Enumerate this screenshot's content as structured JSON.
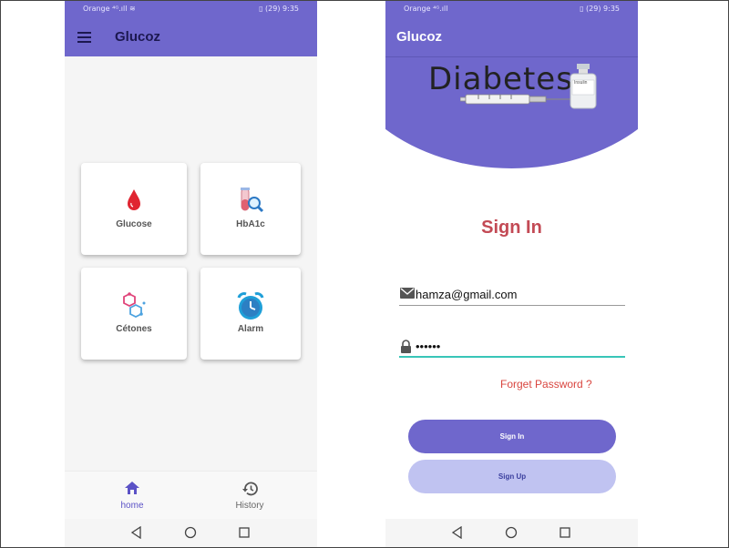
{
  "status_bar": {
    "carrier": "Orange",
    "signal": "⁴ᴳ.ıll",
    "battery": "29",
    "time": "9:35"
  },
  "left_screen": {
    "title": "Glucoz",
    "tiles": [
      {
        "label": "Glucose",
        "icon": "blood-drop-icon"
      },
      {
        "label": "HbA1c",
        "icon": "test-tube-magnifier-icon"
      },
      {
        "label": "Cétones",
        "icon": "molecule-icon"
      },
      {
        "label": "Alarm",
        "icon": "alarm-clock-icon"
      }
    ],
    "bottom_nav": [
      {
        "label": "home",
        "icon": "home-icon",
        "active": true
      },
      {
        "label": "History",
        "icon": "history-icon",
        "active": false
      }
    ]
  },
  "right_screen": {
    "title": "Glucoz",
    "banner_text": "Diabetes",
    "vial_label": "Insulin",
    "heading": "Sign In",
    "email_value": "hamza@gmail.com",
    "password_value": "••••••",
    "forget_link": "Forget Password ?",
    "signin_button": "Sign In",
    "signup_button": "Sign Up"
  },
  "colors": {
    "primary": "#6f67cc",
    "accent_red": "#c34a55",
    "link_red": "#d9453f",
    "teal": "#38c5b8",
    "signup_bg": "#c0c3f1"
  }
}
